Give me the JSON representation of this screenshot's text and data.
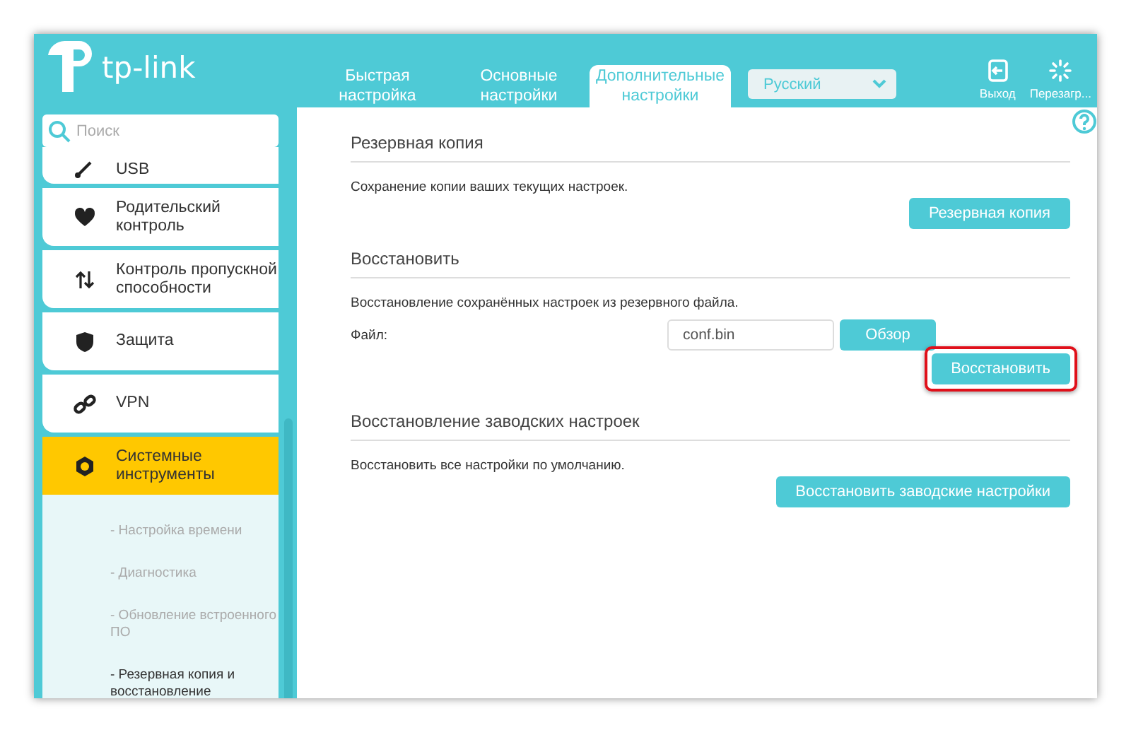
{
  "header": {
    "logo": "tp-link",
    "tabs": [
      {
        "label": "Быстрая настройка",
        "selected": false
      },
      {
        "label": "Основные настройки",
        "selected": false
      },
      {
        "label": "Дополнительные настройки",
        "selected": true
      }
    ],
    "language": "Русский",
    "actions": [
      {
        "label": "Выход",
        "kind": "logout"
      },
      {
        "label": "Перезагр...",
        "kind": "reboot"
      }
    ]
  },
  "sidebar": {
    "search": {
      "placeholder": "Поиск"
    },
    "items": [
      {
        "label": "USB",
        "selected": false,
        "kind": "usb"
      },
      {
        "label": "Родительский контроль",
        "selected": false,
        "kind": "parental"
      },
      {
        "label": "Контроль пропускной способности",
        "selected": false,
        "kind": "bandwidth"
      },
      {
        "label": "Защита",
        "selected": false,
        "kind": "shield"
      },
      {
        "label": "VPN",
        "selected": false,
        "kind": "vpn"
      },
      {
        "label": "Системные инструменты",
        "selected": true,
        "kind": "gear",
        "expanded": true
      }
    ],
    "subitems": [
      {
        "label": "- Настройка времени",
        "selected": false
      },
      {
        "label": "- Диагностика",
        "selected": false
      },
      {
        "label": "- Обновление встроенного ПО",
        "selected": false
      },
      {
        "label": "- Резервная копия и восстановление",
        "selected": true
      }
    ]
  },
  "sections": [
    {
      "title": "Резервная копия",
      "description": "Сохранение копии ваших текущих настроек.",
      "button": {
        "label": "Резервная копия",
        "highlighted": false
      }
    },
    {
      "title": "Восстановить",
      "description": "Восстановление сохранённых настроек из резервного файла.",
      "file": {
        "label": "Файл:",
        "value": "conf.bin",
        "browse": "Обзор"
      },
      "button": {
        "label": "Восстановить",
        "highlighted": true
      }
    },
    {
      "title": "Восстановление заводских настроек",
      "description": "Восстановить все настройки по умолчанию.",
      "button": {
        "label": "Восстановить заводские настройки",
        "highlighted": false
      }
    }
  ]
}
